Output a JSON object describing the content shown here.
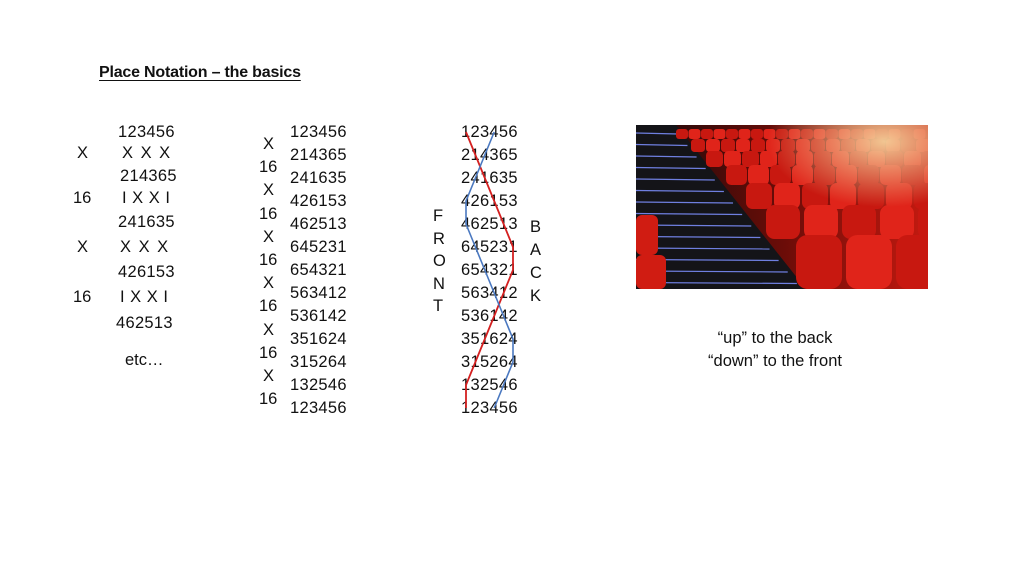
{
  "title": "Place Notation – the basics",
  "example1": {
    "left_labels": [
      "X",
      "16",
      "X",
      "16"
    ],
    "rows": [
      "123456",
      "214365",
      "241635",
      "426153",
      "462513"
    ],
    "changes": [
      "X X X",
      "I X X I",
      "X X X",
      "I X X I"
    ],
    "etc": "etc…"
  },
  "example2": {
    "notation": [
      "X",
      "16",
      "X",
      "16",
      "X",
      "16",
      "X",
      "16",
      "X",
      "16",
      "X",
      "16"
    ],
    "rows": [
      "123456",
      "214365",
      "241635",
      "426153",
      "462513",
      "645231",
      "654321",
      "563412",
      "536142",
      "351624",
      "315264",
      "132546",
      "123456"
    ]
  },
  "example3": {
    "front_label": [
      "F",
      "R",
      "O",
      "N",
      "T"
    ],
    "back_label": [
      "B",
      "A",
      "C",
      "K"
    ],
    "rows": [
      "123456",
      "214365",
      "241635",
      "426153",
      "462513",
      "645231",
      "654321",
      "563412",
      "536142",
      "351624",
      "315264",
      "132546",
      "123456"
    ],
    "traced_bells": [
      {
        "bell": "1",
        "color": "#d42020"
      },
      {
        "bell": "4",
        "color": "#4a78c0"
      }
    ]
  },
  "photo": {
    "description": "red theatre seats beside aisle steps"
  },
  "caption": {
    "line1": "“up” to the back",
    "line2": "“down” to the front"
  }
}
